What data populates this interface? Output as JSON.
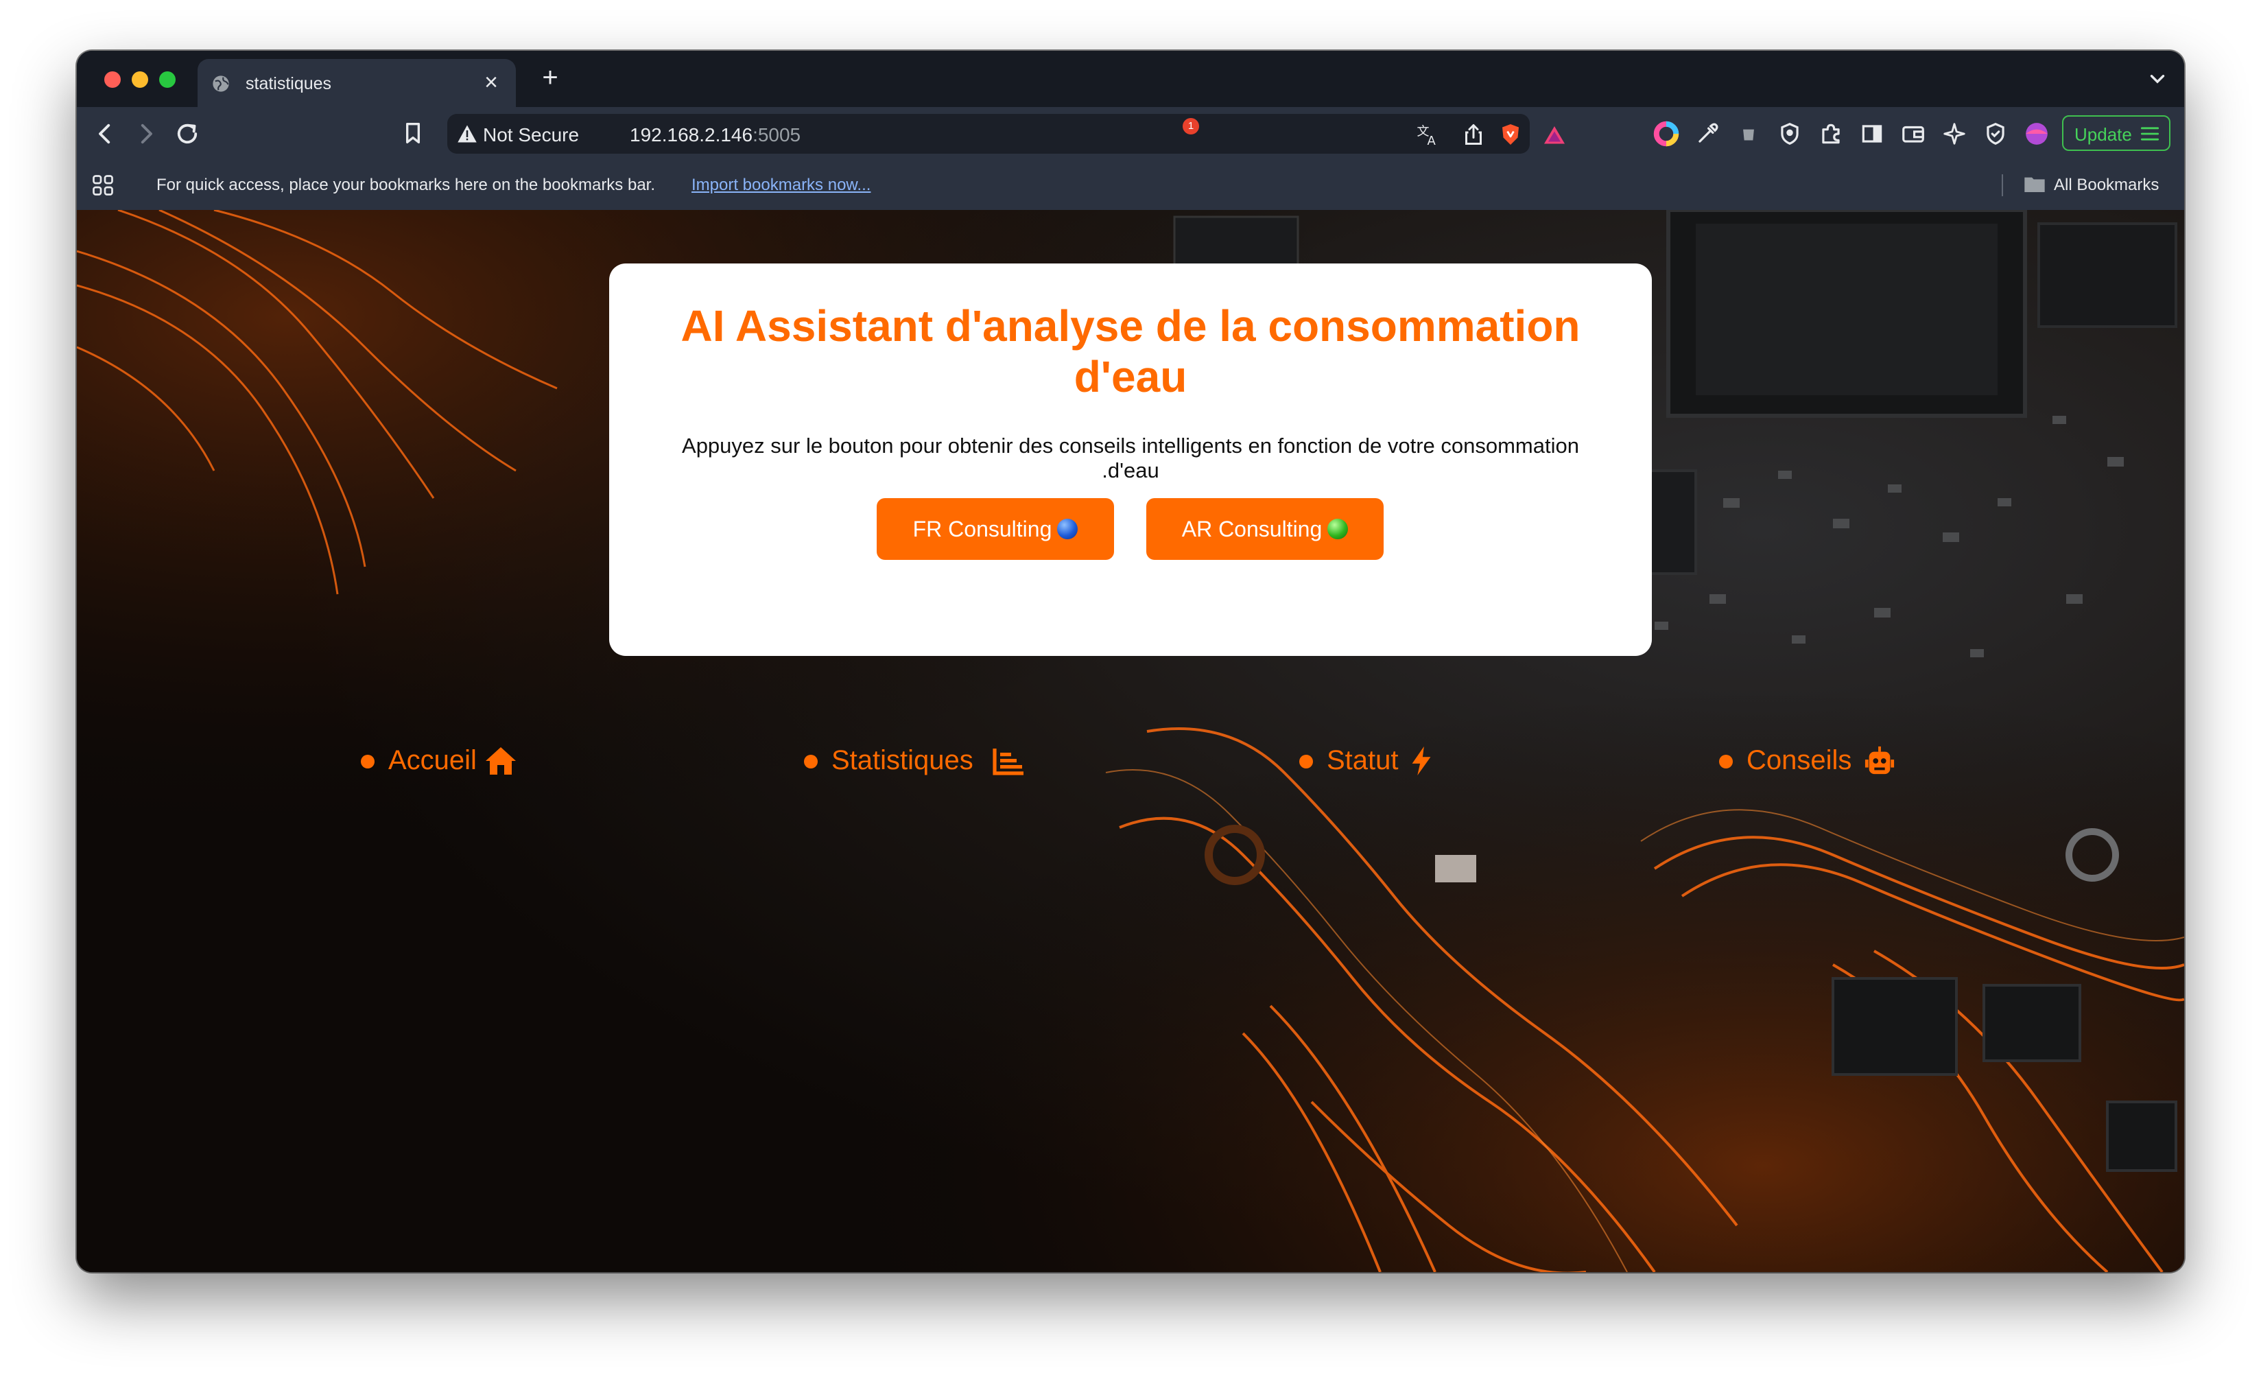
{
  "browser": {
    "tab": {
      "title": "statistiques"
    },
    "address_bar": {
      "security_label": "Not Secure",
      "host": "192.168.2.146",
      "port": ":5005"
    },
    "brave_shield_count": "1",
    "update_button": "Update",
    "bookmarks_bar": {
      "prompt": "For quick access, place your bookmarks here on the bookmarks bar.",
      "import_link": "Import bookmarks now...",
      "all_bookmarks": "All Bookmarks"
    }
  },
  "page": {
    "card": {
      "title": "AI Assistant d'analyse de la consommation d'eau",
      "description": "Appuyez sur le bouton pour obtenir des conseils intelligents en fonction de votre consommation .d'eau",
      "buttons": [
        {
          "label": "FR Consulting",
          "dot_color": "#1e5cd8"
        },
        {
          "label": "AR Consulting",
          "dot_color": "#2fb51f"
        }
      ]
    },
    "nav": [
      {
        "label": "Accueil",
        "icon": "home-icon"
      },
      {
        "label": "Statistiques",
        "icon": "chart-icon"
      },
      {
        "label": "Statut",
        "icon": "bolt-icon"
      },
      {
        "label": "Conseils",
        "icon": "robot-icon"
      }
    ]
  },
  "colors": {
    "accent": "#ff6a00",
    "window_frame": "#161a22",
    "toolbar": "#2b3240",
    "update_green": "#46d35a",
    "link_blue": "#8ab4f8"
  }
}
